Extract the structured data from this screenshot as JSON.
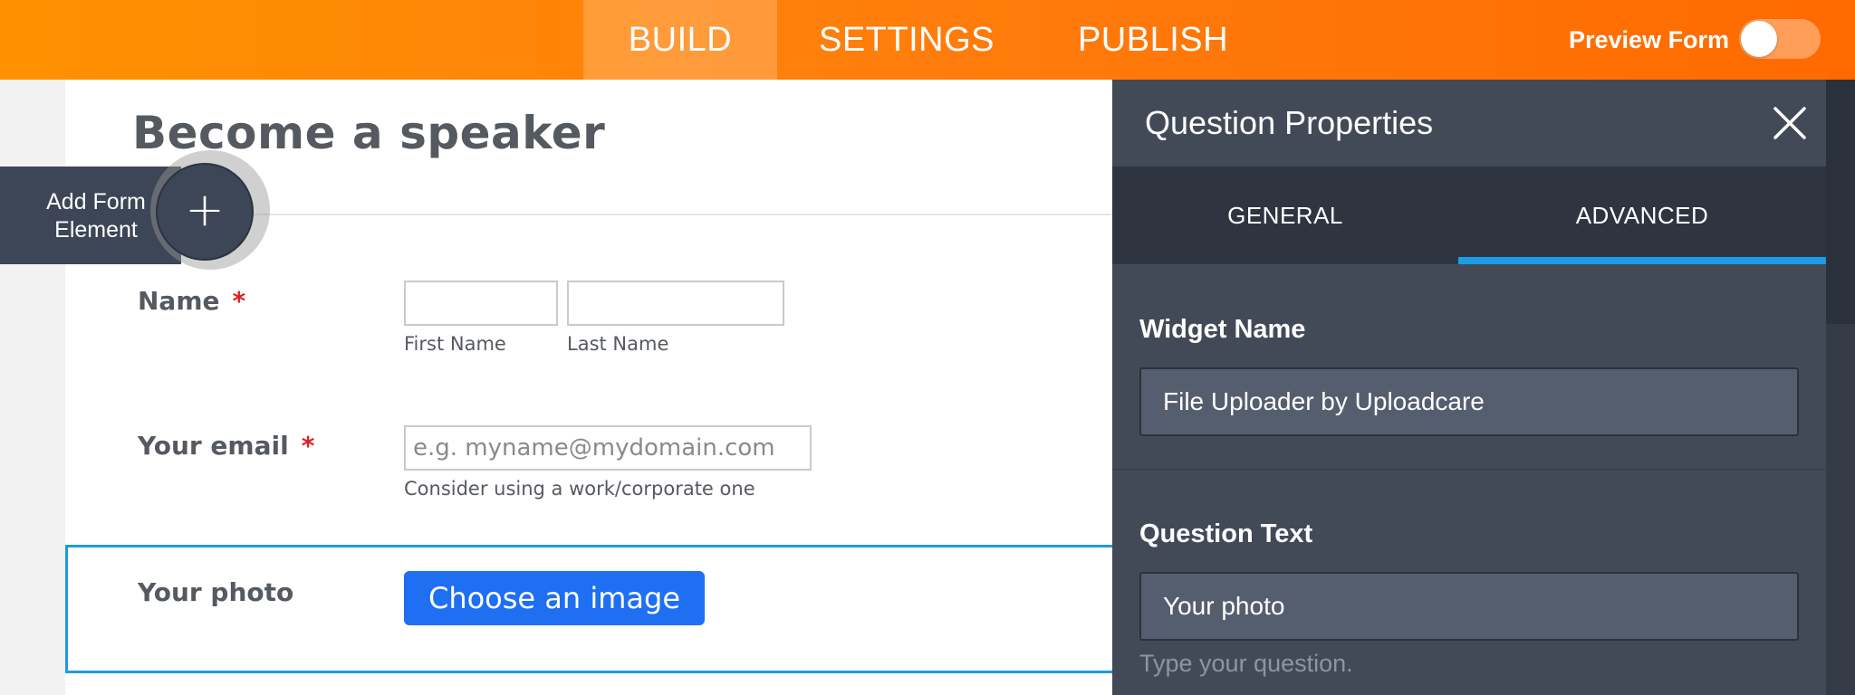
{
  "topbar": {
    "tabs": [
      "BUILD",
      "SETTINGS",
      "PUBLISH"
    ],
    "active_tab": "BUILD",
    "preview_label": "Preview Form",
    "preview_on": false
  },
  "form": {
    "title": "Become a speaker",
    "fields": {
      "name": {
        "label": "Name",
        "required_mark": "*",
        "first_sublabel": "First Name",
        "last_sublabel": "Last Name",
        "first_value": "",
        "last_value": ""
      },
      "email": {
        "label": "Your email",
        "required_mark": "*",
        "placeholder": "e.g. myname@mydomain.com",
        "hint": "Consider using a work/corporate one"
      },
      "photo": {
        "label": "Your photo",
        "button": "Choose an image"
      }
    }
  },
  "add_element": {
    "label": "Add Form Element",
    "icon": "plus-icon"
  },
  "panel": {
    "title": "Question Properties",
    "close_icon": "close-icon",
    "tabs": [
      "GENERAL",
      "ADVANCED"
    ],
    "active_tab": "ADVANCED",
    "widget_name_label": "Widget Name",
    "widget_name_value": "File Uploader by Uploadcare",
    "question_text_label": "Question Text",
    "question_text_value": "Your photo",
    "question_text_hint": "Type your question."
  },
  "colors": {
    "topbar_start": "#ff9100",
    "topbar_end": "#ff6a00",
    "panel_bg": "#434a57",
    "accent_blue": "#1a9ce8",
    "button_blue": "#1e6ff2",
    "required_red": "#e02020"
  }
}
